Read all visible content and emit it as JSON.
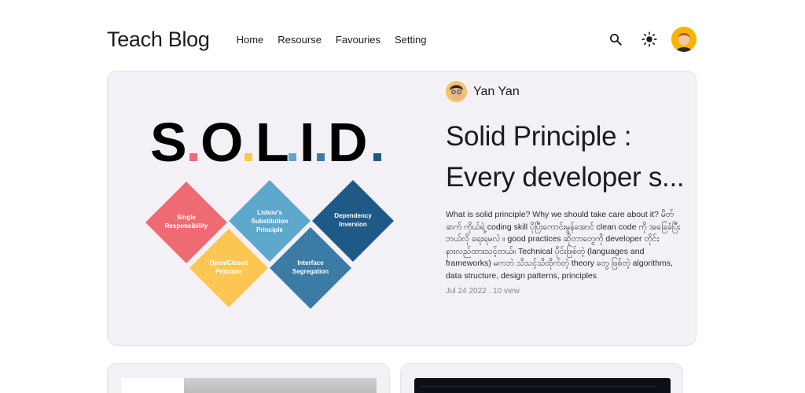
{
  "header": {
    "brand": "Teach Blog",
    "nav": [
      "Home",
      "Resourse",
      "Favouries",
      "Setting"
    ],
    "icons": [
      "search-icon",
      "brightness-icon",
      "user-avatar"
    ]
  },
  "featured": {
    "image_text": "S.O.L.I.D.",
    "principles": [
      {
        "label": "Single Responsibility",
        "color": "#ef6b73"
      },
      {
        "label": "Open/Closed Principle",
        "color": "#fcc652"
      },
      {
        "label": "Liskov's Substitution Principle",
        "color": "#5ea8cc"
      },
      {
        "label": "Interface Segregation",
        "color": "#3b7ca6"
      },
      {
        "label": "Dependency Inversion",
        "color": "#1f5a87"
      }
    ],
    "author": "Yan Yan",
    "title_line1": "Solid Principle :",
    "title_line2": "Every developer s...",
    "excerpt": "What is solid principle? Why we should take care about it? မိတ်ဆက် ကိုယ်ရဲ့ coding skill ပိုပြီးကောင်းမွန်အောင် clean code ကို အခြေခံပြီး ဘယ်လို ရေးရမလဲ ။ good practices ဆိုတာတွေကို developer တိုင်း နားလည်ထားသင့်တယ်။ Technical ပိုင်းဖြစ်တဲ့ (languages and frameworks) မကဘဲ သိသင့်သိထိုက်တဲ့ theory တွေ ဖြစ်တဲ့ algorithms, data structure, design patterns, principles",
    "meta": "Jul 24 2022 . 10 view"
  },
  "colors": {
    "card_bg": "#f4f1f6",
    "dot_red": "#ef6b73",
    "dot_yellow": "#fcc652",
    "dot_blue": "#5ea8cc",
    "dot_navy": "#1f5a87"
  }
}
